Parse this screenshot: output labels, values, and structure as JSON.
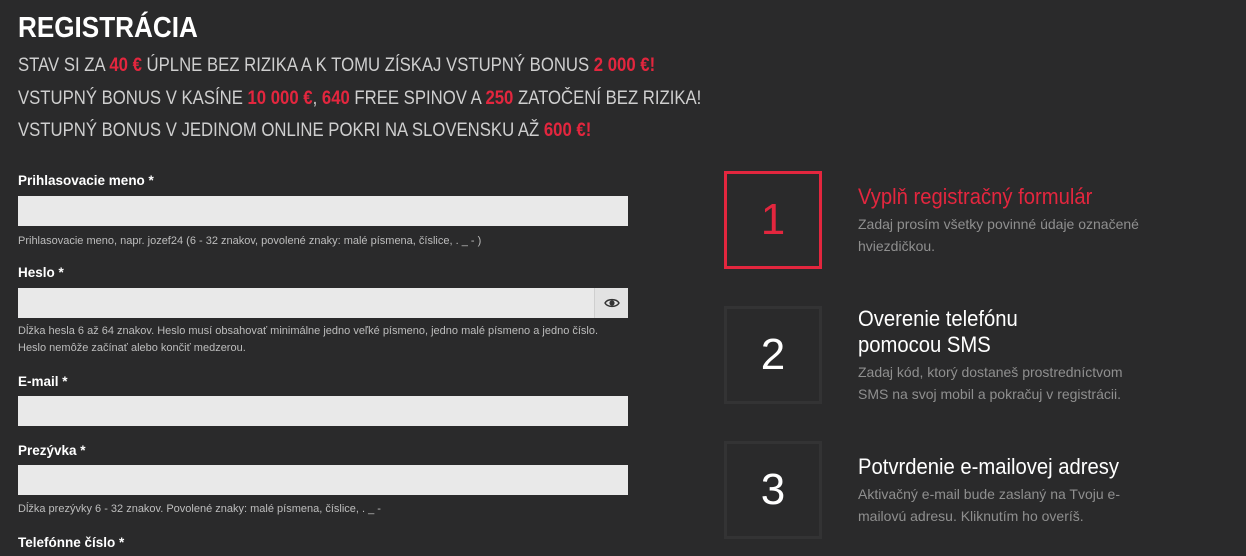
{
  "page": {
    "title": "REGISTRÁCIA",
    "promo1": {
      "a": "STAV SI ZA ",
      "b": "40 €",
      "c": " ÚPLNE BEZ RIZIKA A K TOMU ZÍSKAJ VSTUPNÝ BONUS ",
      "d": "2 000 €!"
    },
    "promo2": {
      "a": "VSTUPNÝ BONUS V KASÍNE ",
      "b": "10 000 €",
      "c": ", ",
      "d": "640",
      "e": " FREE SPINOV A ",
      "f": "250",
      "g": " ZATOČENÍ BEZ RIZIKA!"
    },
    "promo3": {
      "a": "VSTUPNÝ BONUS V JEDINOM ONLINE POKRI NA SLOVENSKU AŽ ",
      "b": "600 €!"
    }
  },
  "form": {
    "username": {
      "label": "Prihlasovacie meno *",
      "value": "",
      "help": "Prihlasovacie meno, napr. jozef24 (6 - 32 znakov, povolené znaky: malé písmena, číslice, . _ - )"
    },
    "password": {
      "label": "Heslo *",
      "value": "",
      "help": "Dĺžka hesla 6 až 64 znakov. Heslo musí obsahovať minimálne jedno veľké písmeno, jedno malé písmeno a jedno číslo. Heslo nemôže začínať alebo končiť medzerou."
    },
    "email": {
      "label": "E-mail *",
      "value": ""
    },
    "nickname": {
      "label": "Prezývka *",
      "value": "",
      "help": "Dĺžka prezývky 6 - 32 znakov. Povolené znaky: malé písmena, číslice, . _ -"
    },
    "phone": {
      "label": "Telefónne číslo *"
    }
  },
  "steps": [
    {
      "number": "1",
      "title": "Vyplň registračný formulár",
      "text": "Zadaj prosím všetky povinné údaje označené hviezdičkou."
    },
    {
      "number": "2",
      "title": "Overenie telefónu pomocou SMS",
      "text": "Zadaj kód, ktorý dostaneš prostredníctvom SMS na svoj mobil a pokračuj v registrácii."
    },
    {
      "number": "3",
      "title": "Potvrdenie e-mailovej adresy",
      "text": "Aktivačný e-mail bude zaslaný na Tvoju e-mailovú adresu. Kliknutím ho overíš."
    }
  ],
  "colors": {
    "accent": "#e3263e",
    "background": "#2a2a2b",
    "input": "#e9e9e9"
  },
  "icons": {
    "password_toggle": "eye-icon"
  }
}
